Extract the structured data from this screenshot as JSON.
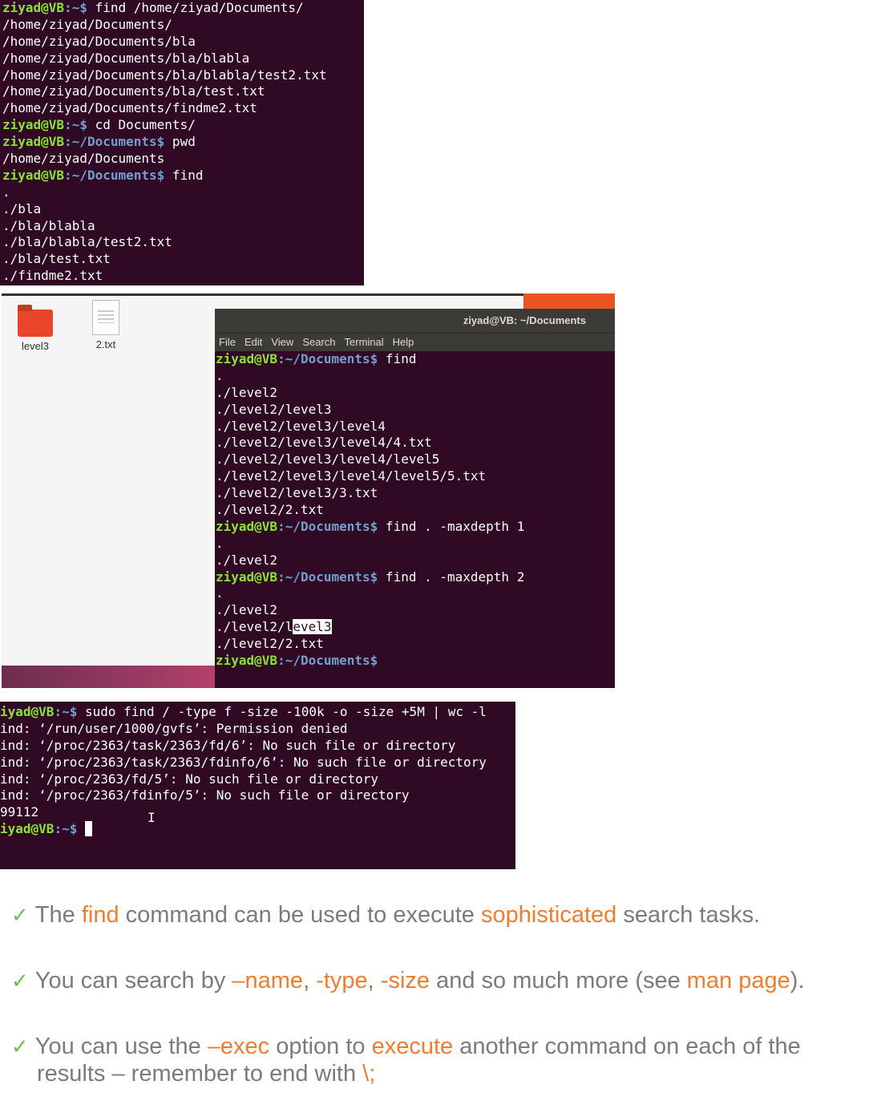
{
  "terminal1": {
    "lines": [
      {
        "user": "ziyad@VB",
        "path": ":~$",
        "cmd": " find /home/ziyad/Documents/"
      },
      {
        "out": "/home/ziyad/Documents/"
      },
      {
        "out": "/home/ziyad/Documents/bla"
      },
      {
        "out": "/home/ziyad/Documents/bla/blabla"
      },
      {
        "out": "/home/ziyad/Documents/bla/blabla/test2.txt"
      },
      {
        "out": "/home/ziyad/Documents/bla/test.txt"
      },
      {
        "out": "/home/ziyad/Documents/findme2.txt"
      },
      {
        "user": "ziyad@VB",
        "path": ":~$",
        "cmd": " cd Documents/"
      },
      {
        "user": "ziyad@VB",
        "path": ":~/Documents$",
        "cmd": " pwd"
      },
      {
        "out": "/home/ziyad/Documents"
      },
      {
        "user": "ziyad@VB",
        "path": ":~/Documents$",
        "cmd": " find"
      },
      {
        "out": "."
      },
      {
        "out": "./bla"
      },
      {
        "out": "./bla/blabla"
      },
      {
        "out": "./bla/blabla/test2.txt"
      },
      {
        "out": "./bla/test.txt"
      },
      {
        "out": "./findme2.txt"
      }
    ]
  },
  "desktop": {
    "icons": [
      {
        "label": "level3",
        "kind": "folder"
      },
      {
        "label": "2.txt",
        "kind": "text-file"
      }
    ],
    "window": {
      "title": "ziyad@VB: ~/Documents",
      "menu": [
        "File",
        "Edit",
        "View",
        "Search",
        "Terminal",
        "Help"
      ],
      "lines": [
        {
          "user": "ziyad@VB",
          "path": ":~/Documents$",
          "cmd": " find"
        },
        {
          "out": "."
        },
        {
          "out": "./level2"
        },
        {
          "out": "./level2/level3"
        },
        {
          "out": "./level2/level3/level4"
        },
        {
          "out": "./level2/level3/level4/4.txt"
        },
        {
          "out": "./level2/level3/level4/level5"
        },
        {
          "out": "./level2/level3/level4/level5/5.txt"
        },
        {
          "out": "./level2/level3/3.txt"
        },
        {
          "out": "./level2/2.txt"
        },
        {
          "user": "ziyad@VB",
          "path": ":~/Documents$",
          "cmd": " find . -maxdepth 1"
        },
        {
          "out": "."
        },
        {
          "out": "./level2"
        },
        {
          "user": "ziyad@VB",
          "path": ":~/Documents$",
          "cmd": " find . -maxdepth 2"
        },
        {
          "out": "."
        },
        {
          "out": "./level2"
        },
        {
          "out": "./level2/l",
          "sel": "evel3"
        },
        {
          "out": "./level2/2.txt"
        },
        {
          "user": "ziyad@VB",
          "path": ":~/Documents$",
          "cmd": ""
        }
      ]
    }
  },
  "terminal3": {
    "lines": [
      {
        "user": "iyad@VB",
        "path": ":~$",
        "cmd": " sudo find / -type f -size -100k -o -size +5M | wc -l"
      },
      {
        "out": "ind: ‘/run/user/1000/gvfs’: Permission denied"
      },
      {
        "out": "ind: ‘/proc/2363/task/2363/fd/6’: No such file or directory"
      },
      {
        "out": "ind: ‘/proc/2363/task/2363/fdinfo/6’: No such file or directory"
      },
      {
        "out": "ind: ‘/proc/2363/fd/5’: No such file or directory"
      },
      {
        "out": "ind: ‘/proc/2363/fdinfo/5’: No such file or directory"
      },
      {
        "out": "99112"
      },
      {
        "user": "iyad@VB",
        "path": ":~$",
        "cmd": " ",
        "cursor": true
      }
    ]
  },
  "bullets": [
    {
      "parts": [
        {
          "t": "The "
        },
        {
          "t": "find",
          "hl": true
        },
        {
          "t": " command can be used to execute "
        },
        {
          "t": "sophisticated",
          "hl": true
        },
        {
          "t": " search tasks."
        }
      ]
    },
    {
      "parts": [
        {
          "t": "You can search by "
        },
        {
          "t": "–name",
          "hl": true
        },
        {
          "t": ", "
        },
        {
          "t": "-type",
          "hl": true
        },
        {
          "t": ", "
        },
        {
          "t": "-size",
          "hl": true
        },
        {
          "t": " and so much more (see "
        },
        {
          "t": "man page",
          "hl": true
        },
        {
          "t": ")."
        }
      ]
    },
    {
      "parts": [
        {
          "t": "You can use the "
        },
        {
          "t": "–exec",
          "hl": true
        },
        {
          "t": " option to "
        },
        {
          "t": "execute",
          "hl": true
        },
        {
          "t": " another command on each of the"
        }
      ]
    },
    {
      "parts": [
        {
          "t": "results – remember to end with "
        },
        {
          "t": "\\;",
          "hl": true
        }
      ]
    }
  ],
  "check_symbol": "✓",
  "colors": {
    "terminal_bg": "#300a24",
    "user": "#8ae234",
    "path": "#729fcf",
    "highlight": "#ef7d2d",
    "check": "#6dbf4b"
  }
}
